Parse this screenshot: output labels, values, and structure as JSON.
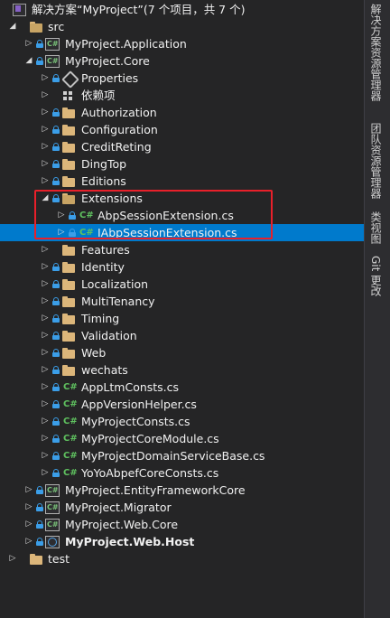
{
  "solution": {
    "label": "解决方案“MyProject”(7 个项目，共 7 个)"
  },
  "tree": {
    "src": "src",
    "application": "MyProject.Application",
    "core": "MyProject.Core",
    "properties": "Properties",
    "dependencies": "依赖项",
    "authorization": "Authorization",
    "configuration": "Configuration",
    "creditreting": "CreditReting",
    "dingtop": "DingTop",
    "editions": "Editions",
    "extensions": "Extensions",
    "abp_session_ext": "AbpSessionExtension.cs",
    "iabp_session_ext": "IAbpSessionExtension.cs",
    "features": "Features",
    "identity": "Identity",
    "localization": "Localization",
    "multitenancy": "MultiTenancy",
    "timing": "Timing",
    "validation": "Validation",
    "web": "Web",
    "wechats": "wechats",
    "appltmconsts": "AppLtmConsts.cs",
    "appversionhelper": "AppVersionHelper.cs",
    "myprojectconsts": "MyProjectConsts.cs",
    "myprojectcoremodule": "MyProjectCoreModule.cs",
    "myprojectdomainservicebase": "MyProjectDomainServiceBase.cs",
    "yoyoabpefcoreconsts": "YoYoAbpefCoreConsts.cs",
    "efcore": "MyProject.EntityFrameworkCore",
    "migrator": "MyProject.Migrator",
    "webcore": "MyProject.Web.Core",
    "webhost": "MyProject.Web.Host",
    "test": "test"
  },
  "side_tabs": {
    "solution_explorer": "解决方案资源管理器",
    "team_explorer": "团队资源管理器",
    "class_view": "类视图",
    "git_changes": "Git 更改"
  },
  "colors": {
    "selection": "#007acc",
    "highlight_box": "#e8202a",
    "background": "#252526"
  }
}
